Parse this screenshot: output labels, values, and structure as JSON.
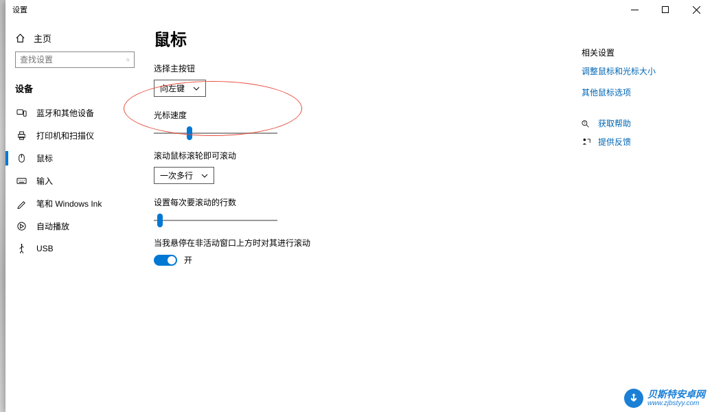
{
  "window": {
    "title": "设置"
  },
  "sidebar": {
    "home": "主页",
    "search_placeholder": "查找设置",
    "section": "设备",
    "items": [
      {
        "label": "蓝牙和其他设备"
      },
      {
        "label": "打印机和扫描仪"
      },
      {
        "label": "鼠标"
      },
      {
        "label": "输入"
      },
      {
        "label": "笔和 Windows Ink"
      },
      {
        "label": "自动播放"
      },
      {
        "label": "USB"
      }
    ]
  },
  "main": {
    "title": "鼠标",
    "primary_button": {
      "label": "选择主按钮",
      "value": "向左键"
    },
    "cursor_speed": {
      "label": "光标速度",
      "value": 28
    },
    "scroll_wheel": {
      "label": "滚动鼠标滚轮即可滚动",
      "value": "一次多行"
    },
    "scroll_lines": {
      "label": "设置每次要滚动的行数",
      "value": 3
    },
    "inactive_hover": {
      "label": "当我悬停在非活动窗口上方时对其进行滚动",
      "state": "开"
    }
  },
  "rail": {
    "header": "相关设置",
    "links": [
      "调整鼠标和光标大小",
      "其他鼠标选项"
    ],
    "help": "获取帮助",
    "feedback": "提供反馈"
  },
  "watermark": {
    "title": "贝斯特安卓网",
    "sub": "www.zjbstyy.com"
  }
}
